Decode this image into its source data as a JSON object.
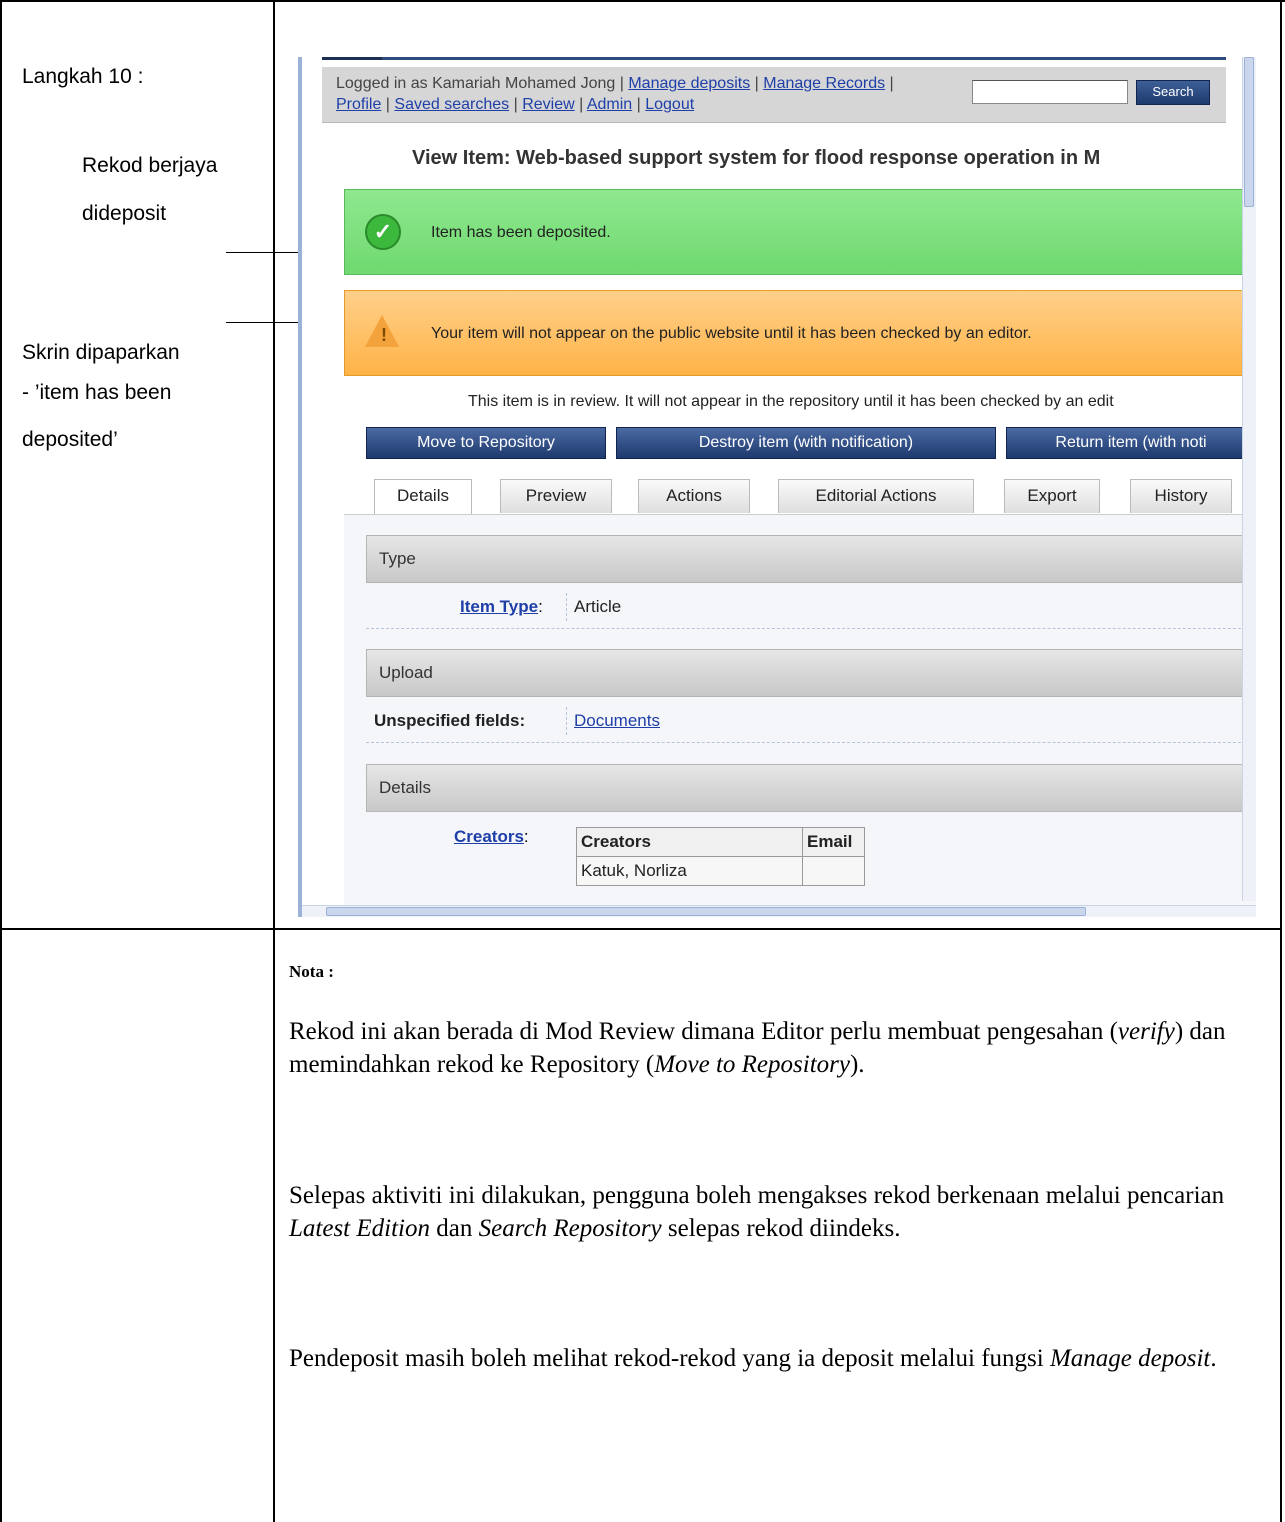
{
  "left": {
    "step": "Langkah 10 :",
    "success_line1": "Rekod berjaya",
    "success_line2": "dideposit",
    "screen_line1": "Skrin dipaparkan",
    "screen_line2": "- ’item has been",
    "screen_line3": "deposited’"
  },
  "screenshot": {
    "menu": {
      "prefix": "Logged in as Kamariah Mohamed Jong |",
      "links": [
        "Manage deposits",
        "Manage Records",
        "Profile",
        "Saved searches",
        "Review",
        "Admin",
        "Logout"
      ],
      "search_button": "Search",
      "search_value": ""
    },
    "view_title": "View Item: Web-based support system for flood response operation in M",
    "success_message": "Item has been deposited.",
    "warning_message": "Your item will not appear on the public website until it has been checked by an editor.",
    "review_note": "This item is in review. It will not appear in the repository until it has been checked by an edit",
    "actions": [
      "Move to Repository",
      "Destroy item (with notification)",
      "Return item (with noti"
    ],
    "tabs": [
      "Details",
      "Preview",
      "Actions",
      "Editorial Actions",
      "Export",
      "History"
    ],
    "sections": {
      "type": {
        "heading": "Type",
        "label": "Item Type",
        "value": "Article"
      },
      "upload": {
        "heading": "Upload",
        "label": "Unspecified fields:",
        "value": "Documents"
      },
      "details": {
        "heading": "Details",
        "label": "Creators",
        "columns": [
          "Creators",
          "Email"
        ],
        "rows": [
          "Katuk, Norliza"
        ]
      }
    }
  },
  "nota": {
    "title": "Nota :",
    "p1_a": "Rekod ini akan berada di Mod Review dimana Editor perlu membuat pengesahan (",
    "p1_i1": "verify",
    "p1_b": ") dan memindahkan rekod ke Repository (",
    "p1_i2": "Move to Repository",
    "p1_c": ").",
    "p2_a": "Selepas aktiviti ini dilakukan, pengguna boleh mengakses rekod berkenaan melalui pencarian ",
    "p2_i1": "Latest Edition",
    "p2_b": " dan ",
    "p2_i2": "Search Repository",
    "p2_c": " selepas rekod diindeks.",
    "p3_a": "Pendeposit masih boleh melihat rekod-rekod yang ia deposit melalui fungsi ",
    "p3_i1": "Manage deposit",
    "p3_b": "."
  }
}
